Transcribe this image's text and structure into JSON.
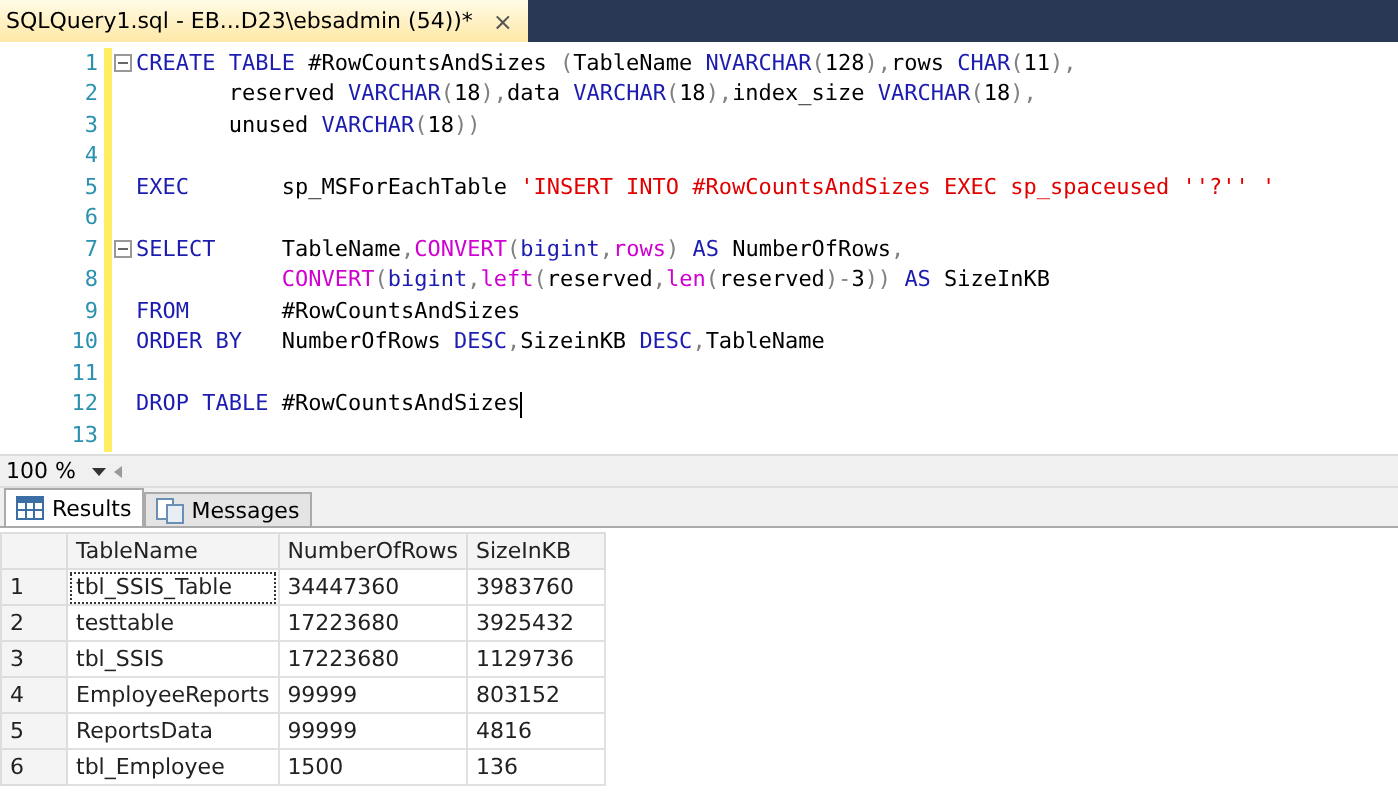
{
  "document_tab": {
    "title": "SQLQuery1.sql - EB...D23\\ebsadmin (54))*",
    "close": "×"
  },
  "editor": {
    "lines": [
      {
        "number": "1",
        "fold_start": true,
        "caret": false,
        "segments": [
          {
            "kind": "keyword",
            "text": "CREATE TABLE"
          },
          {
            "kind": "plain",
            "text": " #RowCountsAndSizes "
          },
          {
            "kind": "operator",
            "text": "("
          },
          {
            "kind": "plain",
            "text": "TableName "
          },
          {
            "kind": "keyword",
            "text": "NVARCHAR"
          },
          {
            "kind": "operator",
            "text": "("
          },
          {
            "kind": "plain",
            "text": "128"
          },
          {
            "kind": "operator",
            "text": "),"
          },
          {
            "kind": "plain",
            "text": "rows "
          },
          {
            "kind": "keyword",
            "text": "CHAR"
          },
          {
            "kind": "operator",
            "text": "("
          },
          {
            "kind": "plain",
            "text": "11"
          },
          {
            "kind": "operator",
            "text": "),"
          }
        ]
      },
      {
        "number": "2",
        "fold_start": false,
        "caret": false,
        "segments": [
          {
            "kind": "plain",
            "text": "       reserved "
          },
          {
            "kind": "keyword",
            "text": "VARCHAR"
          },
          {
            "kind": "operator",
            "text": "("
          },
          {
            "kind": "plain",
            "text": "18"
          },
          {
            "kind": "operator",
            "text": "),"
          },
          {
            "kind": "plain",
            "text": "data "
          },
          {
            "kind": "keyword",
            "text": "VARCHAR"
          },
          {
            "kind": "operator",
            "text": "("
          },
          {
            "kind": "plain",
            "text": "18"
          },
          {
            "kind": "operator",
            "text": "),"
          },
          {
            "kind": "plain",
            "text": "index_size "
          },
          {
            "kind": "keyword",
            "text": "VARCHAR"
          },
          {
            "kind": "operator",
            "text": "("
          },
          {
            "kind": "plain",
            "text": "18"
          },
          {
            "kind": "operator",
            "text": "),"
          }
        ]
      },
      {
        "number": "3",
        "fold_start": false,
        "caret": false,
        "segments": [
          {
            "kind": "plain",
            "text": "       unused "
          },
          {
            "kind": "keyword",
            "text": "VARCHAR"
          },
          {
            "kind": "operator",
            "text": "("
          },
          {
            "kind": "plain",
            "text": "18"
          },
          {
            "kind": "operator",
            "text": "))"
          }
        ]
      },
      {
        "number": "4",
        "fold_start": false,
        "caret": false
      },
      {
        "number": "5",
        "fold_start": false,
        "caret": false,
        "segments": [
          {
            "kind": "keyword",
            "text": "EXEC"
          },
          {
            "kind": "plain",
            "text": "       sp_MSForEachTable "
          },
          {
            "kind": "string",
            "text": "'INSERT INTO #RowCountsAndSizes EXEC sp_spaceused ''?'' '"
          }
        ]
      },
      {
        "number": "6",
        "fold_start": false,
        "caret": false
      },
      {
        "number": "7",
        "fold_start": true,
        "caret": false,
        "segments": [
          {
            "kind": "keyword",
            "text": "SELECT"
          },
          {
            "kind": "plain",
            "text": "     TableName"
          },
          {
            "kind": "operator",
            "text": ","
          },
          {
            "kind": "function",
            "text": "CONVERT"
          },
          {
            "kind": "operator",
            "text": "("
          },
          {
            "kind": "keyword",
            "text": "bigint"
          },
          {
            "kind": "operator",
            "text": ","
          },
          {
            "kind": "function",
            "text": "rows"
          },
          {
            "kind": "operator",
            "text": ") "
          },
          {
            "kind": "keyword",
            "text": "AS"
          },
          {
            "kind": "plain",
            "text": " NumberOfRows"
          },
          {
            "kind": "operator",
            "text": ","
          }
        ]
      },
      {
        "number": "8",
        "fold_start": false,
        "caret": false,
        "segments": [
          {
            "kind": "function",
            "text": "           CONVERT"
          },
          {
            "kind": "operator",
            "text": "("
          },
          {
            "kind": "keyword",
            "text": "bigint"
          },
          {
            "kind": "operator",
            "text": ","
          },
          {
            "kind": "function",
            "text": "left"
          },
          {
            "kind": "operator",
            "text": "("
          },
          {
            "kind": "plain",
            "text": "reserved"
          },
          {
            "kind": "operator",
            "text": ","
          },
          {
            "kind": "function",
            "text": "len"
          },
          {
            "kind": "operator",
            "text": "("
          },
          {
            "kind": "plain",
            "text": "reserved"
          },
          {
            "kind": "operator",
            "text": ")-"
          },
          {
            "kind": "plain",
            "text": "3"
          },
          {
            "kind": "operator",
            "text": ")) "
          },
          {
            "kind": "keyword",
            "text": "AS"
          },
          {
            "kind": "plain",
            "text": " SizeInKB"
          }
        ]
      },
      {
        "number": "9",
        "fold_start": false,
        "caret": false,
        "segments": [
          {
            "kind": "keyword",
            "text": "FROM"
          },
          {
            "kind": "plain",
            "text": "       #RowCountsAndSizes"
          }
        ]
      },
      {
        "number": "10",
        "fold_start": false,
        "caret": false,
        "segments": [
          {
            "kind": "keyword",
            "text": "ORDER BY"
          },
          {
            "kind": "plain",
            "text": "   NumberOfRows "
          },
          {
            "kind": "keyword",
            "text": "DESC"
          },
          {
            "kind": "operator",
            "text": ","
          },
          {
            "kind": "plain",
            "text": "SizeinKB "
          },
          {
            "kind": "keyword",
            "text": "DESC"
          },
          {
            "kind": "operator",
            "text": ","
          },
          {
            "kind": "plain",
            "text": "TableName"
          }
        ]
      },
      {
        "number": "11",
        "fold_start": false,
        "caret": false
      },
      {
        "number": "12",
        "fold_start": false,
        "caret": true,
        "segments": [
          {
            "kind": "keyword",
            "text": "DROP TABLE"
          },
          {
            "kind": "plain",
            "text": " #RowCountsAndSizes"
          }
        ]
      },
      {
        "number": "13",
        "fold_start": false,
        "caret": false
      }
    ]
  },
  "zoom": {
    "value": "100 %"
  },
  "result_tabs": [
    {
      "label": "Results",
      "selected": true
    },
    {
      "label": "Messages",
      "selected": false
    }
  ],
  "grid": {
    "columns": [
      "TableName",
      "NumberOfRows",
      "SizeInKB"
    ],
    "rows": [
      {
        "number": "1",
        "cells": [
          "tbl_SSIS_Table",
          "34447360",
          "3983760"
        ],
        "focused_cell": true
      },
      {
        "number": "2",
        "cells": [
          "testtable",
          "17223680",
          "3925432"
        ],
        "focused_cell": false
      },
      {
        "number": "3",
        "cells": [
          "tbl_SSIS",
          "17223680",
          "1129736"
        ],
        "focused_cell": false
      },
      {
        "number": "4",
        "cells": [
          "EmployeeReports",
          "99999",
          "803152"
        ],
        "focused_cell": false
      },
      {
        "number": "5",
        "cells": [
          "ReportsData",
          "99999",
          "4816"
        ],
        "focused_cell": false
      },
      {
        "number": "6",
        "cells": [
          "tbl_Employee",
          "1500",
          "136"
        ],
        "focused_cell": false
      }
    ]
  }
}
